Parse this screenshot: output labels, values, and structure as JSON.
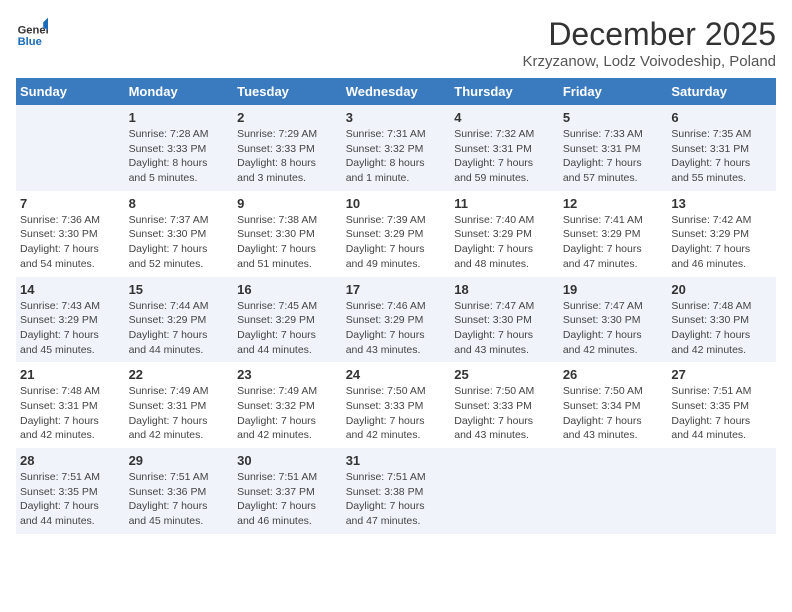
{
  "header": {
    "logo_general": "General",
    "logo_blue": "Blue",
    "month_title": "December 2025",
    "subtitle": "Krzyzanow, Lodz Voivodeship, Poland"
  },
  "days_of_week": [
    "Sunday",
    "Monday",
    "Tuesday",
    "Wednesday",
    "Thursday",
    "Friday",
    "Saturday"
  ],
  "weeks": [
    [
      {
        "day": "",
        "info": ""
      },
      {
        "day": "1",
        "info": "Sunrise: 7:28 AM\nSunset: 3:33 PM\nDaylight: 8 hours\nand 5 minutes."
      },
      {
        "day": "2",
        "info": "Sunrise: 7:29 AM\nSunset: 3:33 PM\nDaylight: 8 hours\nand 3 minutes."
      },
      {
        "day": "3",
        "info": "Sunrise: 7:31 AM\nSunset: 3:32 PM\nDaylight: 8 hours\nand 1 minute."
      },
      {
        "day": "4",
        "info": "Sunrise: 7:32 AM\nSunset: 3:31 PM\nDaylight: 7 hours\nand 59 minutes."
      },
      {
        "day": "5",
        "info": "Sunrise: 7:33 AM\nSunset: 3:31 PM\nDaylight: 7 hours\nand 57 minutes."
      },
      {
        "day": "6",
        "info": "Sunrise: 7:35 AM\nSunset: 3:31 PM\nDaylight: 7 hours\nand 55 minutes."
      }
    ],
    [
      {
        "day": "7",
        "info": "Sunrise: 7:36 AM\nSunset: 3:30 PM\nDaylight: 7 hours\nand 54 minutes."
      },
      {
        "day": "8",
        "info": "Sunrise: 7:37 AM\nSunset: 3:30 PM\nDaylight: 7 hours\nand 52 minutes."
      },
      {
        "day": "9",
        "info": "Sunrise: 7:38 AM\nSunset: 3:30 PM\nDaylight: 7 hours\nand 51 minutes."
      },
      {
        "day": "10",
        "info": "Sunrise: 7:39 AM\nSunset: 3:29 PM\nDaylight: 7 hours\nand 49 minutes."
      },
      {
        "day": "11",
        "info": "Sunrise: 7:40 AM\nSunset: 3:29 PM\nDaylight: 7 hours\nand 48 minutes."
      },
      {
        "day": "12",
        "info": "Sunrise: 7:41 AM\nSunset: 3:29 PM\nDaylight: 7 hours\nand 47 minutes."
      },
      {
        "day": "13",
        "info": "Sunrise: 7:42 AM\nSunset: 3:29 PM\nDaylight: 7 hours\nand 46 minutes."
      }
    ],
    [
      {
        "day": "14",
        "info": "Sunrise: 7:43 AM\nSunset: 3:29 PM\nDaylight: 7 hours\nand 45 minutes."
      },
      {
        "day": "15",
        "info": "Sunrise: 7:44 AM\nSunset: 3:29 PM\nDaylight: 7 hours\nand 44 minutes."
      },
      {
        "day": "16",
        "info": "Sunrise: 7:45 AM\nSunset: 3:29 PM\nDaylight: 7 hours\nand 44 minutes."
      },
      {
        "day": "17",
        "info": "Sunrise: 7:46 AM\nSunset: 3:29 PM\nDaylight: 7 hours\nand 43 minutes."
      },
      {
        "day": "18",
        "info": "Sunrise: 7:47 AM\nSunset: 3:30 PM\nDaylight: 7 hours\nand 43 minutes."
      },
      {
        "day": "19",
        "info": "Sunrise: 7:47 AM\nSunset: 3:30 PM\nDaylight: 7 hours\nand 42 minutes."
      },
      {
        "day": "20",
        "info": "Sunrise: 7:48 AM\nSunset: 3:30 PM\nDaylight: 7 hours\nand 42 minutes."
      }
    ],
    [
      {
        "day": "21",
        "info": "Sunrise: 7:48 AM\nSunset: 3:31 PM\nDaylight: 7 hours\nand 42 minutes."
      },
      {
        "day": "22",
        "info": "Sunrise: 7:49 AM\nSunset: 3:31 PM\nDaylight: 7 hours\nand 42 minutes."
      },
      {
        "day": "23",
        "info": "Sunrise: 7:49 AM\nSunset: 3:32 PM\nDaylight: 7 hours\nand 42 minutes."
      },
      {
        "day": "24",
        "info": "Sunrise: 7:50 AM\nSunset: 3:33 PM\nDaylight: 7 hours\nand 42 minutes."
      },
      {
        "day": "25",
        "info": "Sunrise: 7:50 AM\nSunset: 3:33 PM\nDaylight: 7 hours\nand 43 minutes."
      },
      {
        "day": "26",
        "info": "Sunrise: 7:50 AM\nSunset: 3:34 PM\nDaylight: 7 hours\nand 43 minutes."
      },
      {
        "day": "27",
        "info": "Sunrise: 7:51 AM\nSunset: 3:35 PM\nDaylight: 7 hours\nand 44 minutes."
      }
    ],
    [
      {
        "day": "28",
        "info": "Sunrise: 7:51 AM\nSunset: 3:35 PM\nDaylight: 7 hours\nand 44 minutes."
      },
      {
        "day": "29",
        "info": "Sunrise: 7:51 AM\nSunset: 3:36 PM\nDaylight: 7 hours\nand 45 minutes."
      },
      {
        "day": "30",
        "info": "Sunrise: 7:51 AM\nSunset: 3:37 PM\nDaylight: 7 hours\nand 46 minutes."
      },
      {
        "day": "31",
        "info": "Sunrise: 7:51 AM\nSunset: 3:38 PM\nDaylight: 7 hours\nand 47 minutes."
      },
      {
        "day": "",
        "info": ""
      },
      {
        "day": "",
        "info": ""
      },
      {
        "day": "",
        "info": ""
      }
    ]
  ]
}
